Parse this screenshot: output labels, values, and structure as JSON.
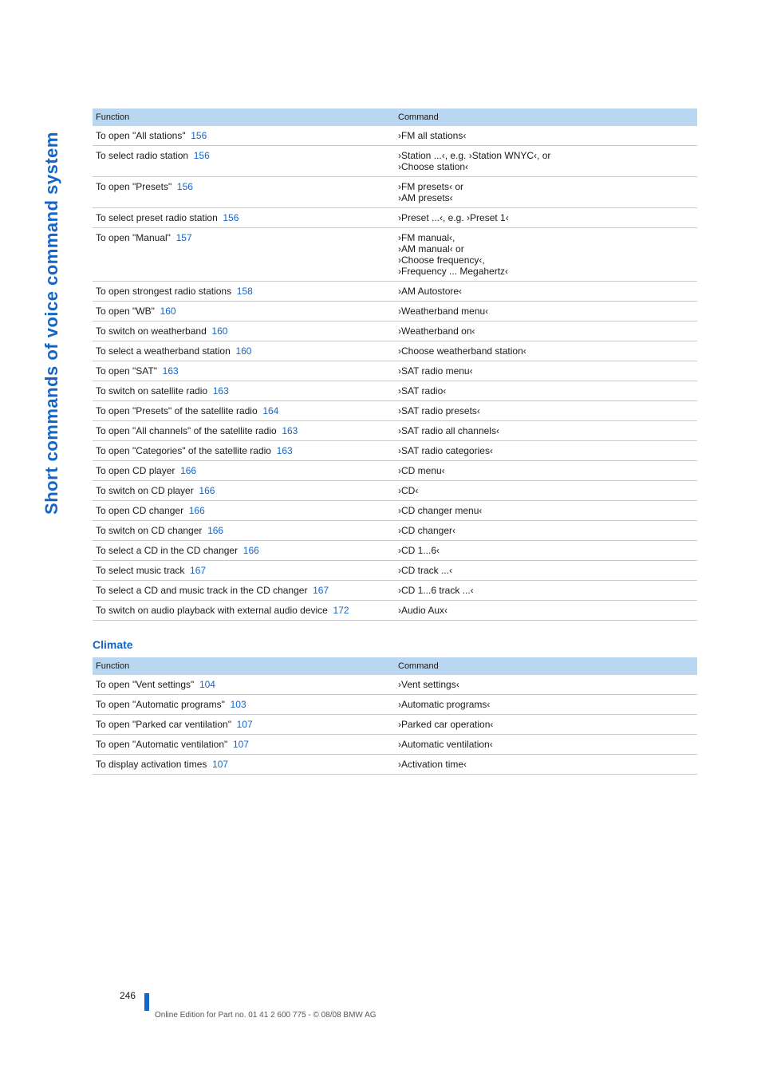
{
  "tabTitle": "Short commands of voice command system",
  "tables": [
    {
      "headers": {
        "func": "Function",
        "cmd": "Command"
      },
      "rows": [
        {
          "func": "To open \"All stations\"",
          "page": "156",
          "cmd": "›FM all stations‹"
        },
        {
          "func": "To select radio station",
          "page": "156",
          "cmd": "›Station ...‹, e.g. ›Station WNYC‹, or\n›Choose station‹"
        },
        {
          "func": "To open \"Presets\"",
          "page": "156",
          "cmd": "›FM presets‹ or\n›AM presets‹"
        },
        {
          "func": "To select preset radio station",
          "page": "156",
          "cmd": "›Preset ...‹, e.g. ›Preset 1‹"
        },
        {
          "func": "To open \"Manual\"",
          "page": "157",
          "cmd": "›FM manual‹,\n›AM manual‹ or\n›Choose frequency‹,\n›Frequency ... Megahertz‹"
        },
        {
          "func": "To open strongest radio stations",
          "page": "158",
          "cmd": "›AM Autostore‹"
        },
        {
          "func": "To open \"WB\"",
          "page": "160",
          "cmd": "›Weatherband menu‹"
        },
        {
          "func": "To switch on weatherband",
          "page": "160",
          "cmd": "›Weatherband on‹"
        },
        {
          "func": "To select a weatherband station",
          "page": "160",
          "cmd": "›Choose weatherband station‹"
        },
        {
          "func": "To open \"SAT\"",
          "page": "163",
          "cmd": "›SAT radio menu‹"
        },
        {
          "func": "To switch on satellite radio",
          "page": "163",
          "cmd": "›SAT radio‹"
        },
        {
          "func": "To open \"Presets\" of the satellite radio",
          "page": "164",
          "cmd": "›SAT radio presets‹"
        },
        {
          "func": "To open \"All channels\" of the satellite radio",
          "page": "163",
          "cmd": "›SAT radio all channels‹"
        },
        {
          "func": "To open \"Categories\" of the satellite radio",
          "page": "163",
          "cmd": "›SAT radio categories‹"
        },
        {
          "func": "To open CD player",
          "page": "166",
          "cmd": "›CD menu‹"
        },
        {
          "func": "To switch on CD player",
          "page": "166",
          "cmd": "›CD‹"
        },
        {
          "func": "To open CD changer",
          "page": "166",
          "cmd": "›CD changer menu‹"
        },
        {
          "func": "To switch on CD changer",
          "page": "166",
          "cmd": "›CD changer‹"
        },
        {
          "func": "To select a CD in the CD changer",
          "page": "166",
          "cmd": "›CD 1...6‹"
        },
        {
          "func": "To select music track",
          "page": "167",
          "cmd": "›CD track ...‹"
        },
        {
          "func": "To select a CD and music track in the CD changer",
          "page": "167",
          "cmd": "›CD 1...6 track ...‹"
        },
        {
          "func": "To switch on audio playback with external audio device",
          "page": "172",
          "cmd": "›Audio Aux‹"
        }
      ]
    },
    {
      "title": "Climate",
      "headers": {
        "func": "Function",
        "cmd": "Command"
      },
      "rows": [
        {
          "func": "To open \"Vent settings\"",
          "page": "104",
          "cmd": "›Vent settings‹"
        },
        {
          "func": "To open \"Automatic programs\"",
          "page": "103",
          "cmd": "›Automatic programs‹"
        },
        {
          "func": "To open \"Parked car ventilation\"",
          "page": "107",
          "cmd": "›Parked car operation‹"
        },
        {
          "func": "To open \"Automatic ventilation\"",
          "page": "107",
          "cmd": "›Automatic ventilation‹"
        },
        {
          "func": "To display activation times",
          "page": "107",
          "cmd": "›Activation time‹"
        }
      ]
    }
  ],
  "footer": {
    "pageNumber": "246",
    "line": "Online Edition for Part no. 01 41 2 600 775 - © 08/08 BMW AG"
  }
}
